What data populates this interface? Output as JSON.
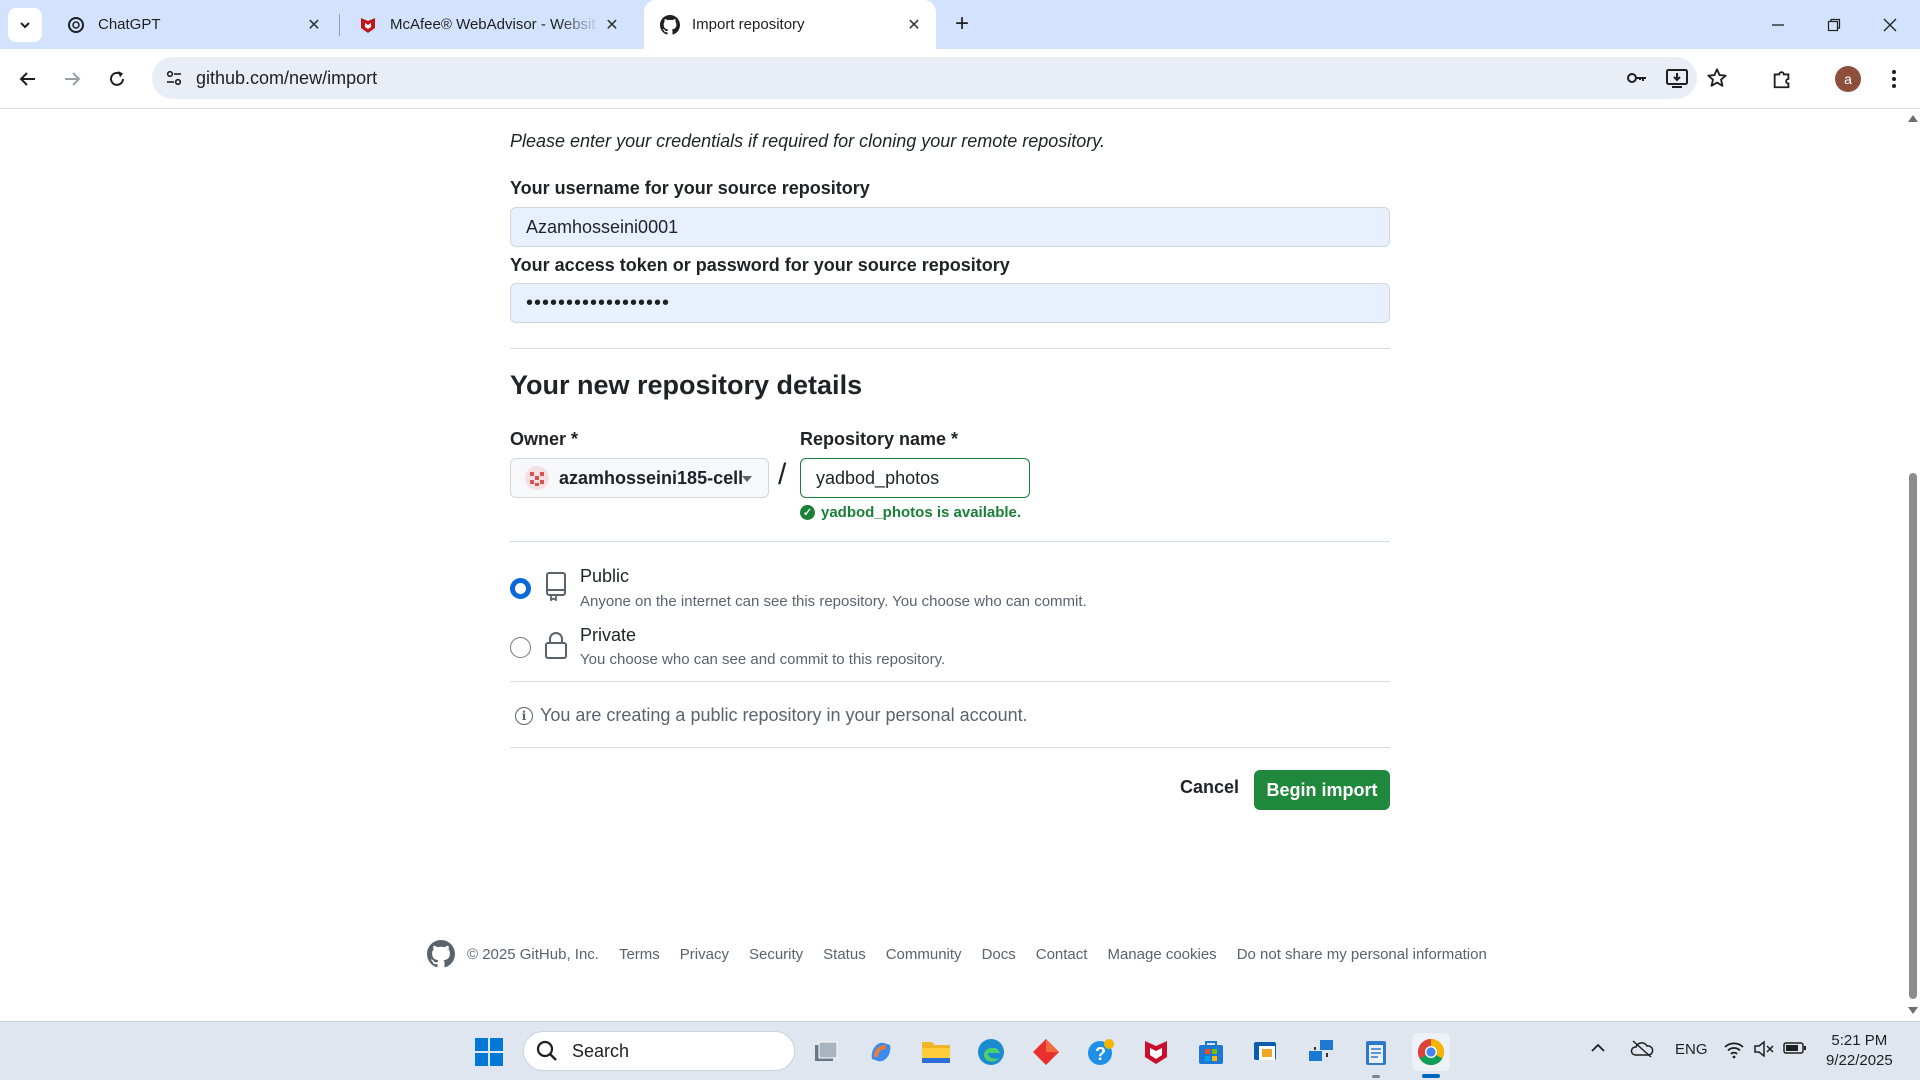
{
  "browser": {
    "tabs": [
      {
        "title": "ChatGPT",
        "icon": "chatgpt-icon",
        "active": false
      },
      {
        "title": "McAfee® WebAdvisor - Websit",
        "icon": "mcafee-icon",
        "active": false
      },
      {
        "title": "Import repository",
        "icon": "github-icon",
        "active": true
      }
    ],
    "url": "github.com/new/import",
    "profile_initial": "a"
  },
  "credentials": {
    "hint": "Please enter your credentials if required for cloning your remote repository.",
    "username_label": "Your username for your source repository",
    "username_value": "Azamhosseini0001",
    "password_label": "Your access token or password for your source repository",
    "password_value": "••••••••••••••••••"
  },
  "details": {
    "title": "Your new repository details",
    "owner_label": "Owner *",
    "owner_value": "azamhosseini185-cell",
    "slash": "/",
    "repo_label": "Repository name *",
    "repo_value": "yadbod_photos",
    "availability": "yadbod_photos is available."
  },
  "visibility": {
    "public_title": "Public",
    "public_desc": "Anyone on the internet can see this repository. You choose who can commit.",
    "private_title": "Private",
    "private_desc": "You choose who can see and commit to this repository.",
    "selected": "public"
  },
  "notice": "You are creating a public repository in your personal account.",
  "actions": {
    "cancel": "Cancel",
    "begin": "Begin import"
  },
  "footer": {
    "copyright": "© 2025 GitHub, Inc.",
    "links": [
      "Terms",
      "Privacy",
      "Security",
      "Status",
      "Community",
      "Docs",
      "Contact",
      "Manage cookies",
      "Do not share my personal information"
    ]
  },
  "taskbar": {
    "search_placeholder": "Search",
    "language": "ENG",
    "time": "5:21 PM",
    "date": "9/22/2025"
  },
  "colors": {
    "primary_button": "#1f883d",
    "success": "#1a7f37",
    "radio_selected": "#0969da",
    "tabbar": "#d3e3fd"
  }
}
